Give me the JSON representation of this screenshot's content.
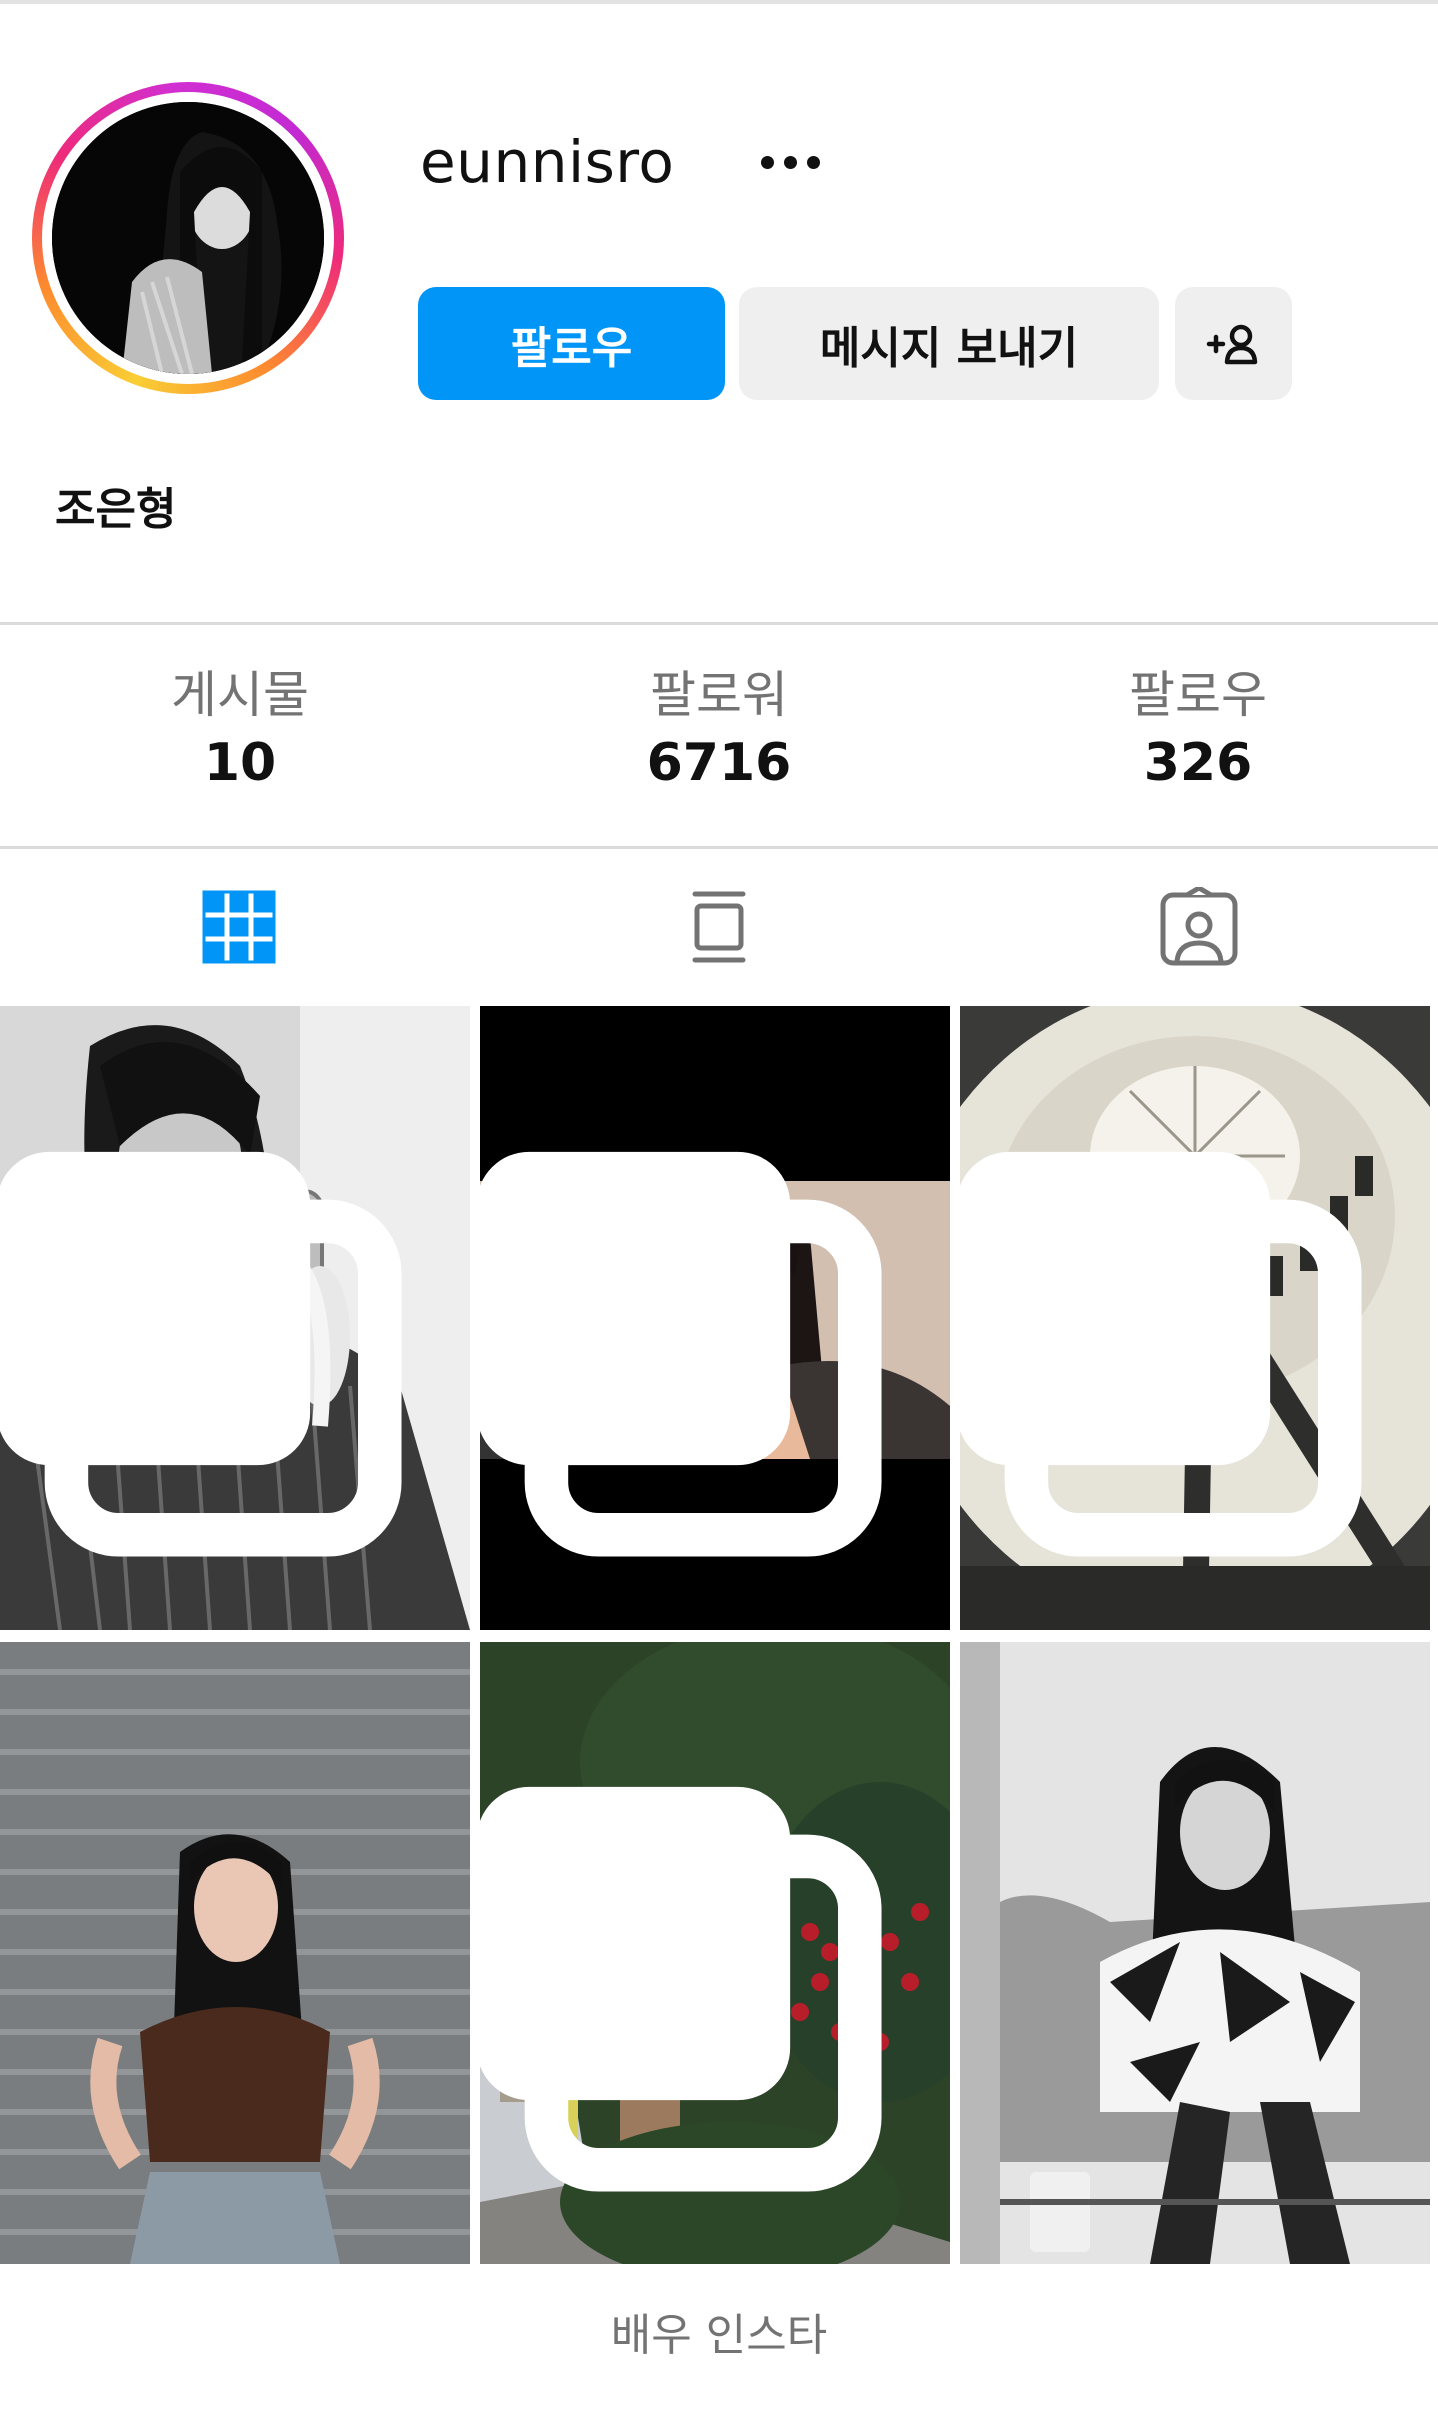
{
  "profile": {
    "username": "eunnisro",
    "full_name": "조은형"
  },
  "actions": {
    "follow_label": "팔로우",
    "message_label": "메시지 보내기",
    "add_person_icon": "add-person-icon",
    "more_icon": "more-options-icon"
  },
  "stats": {
    "posts_label": "게시물",
    "posts_value": "10",
    "followers_label": "팔로워",
    "followers_value": "6716",
    "following_label": "팔로우",
    "following_value": "326"
  },
  "tabs": [
    {
      "icon": "grid-icon",
      "active": true
    },
    {
      "icon": "reels-feed-icon",
      "active": false
    },
    {
      "icon": "tagged-icon",
      "active": false
    }
  ],
  "posts": [
    {
      "image": "mirror-selfie-bw",
      "multi": true
    },
    {
      "image": "video-selfie-color",
      "multi": true
    },
    {
      "image": "dome-ceiling-bw",
      "multi": true
    },
    {
      "image": "brick-wall-portrait",
      "multi": false
    },
    {
      "image": "street-garden-color",
      "multi": true
    },
    {
      "image": "sofa-portrait-bw",
      "multi": false
    }
  ],
  "caption": "배우 인스타",
  "colors": {
    "follow_button": "#0095f6",
    "active_tab": "#0095f6",
    "secondary_button": "#efefef",
    "muted_text": "#737373"
  }
}
